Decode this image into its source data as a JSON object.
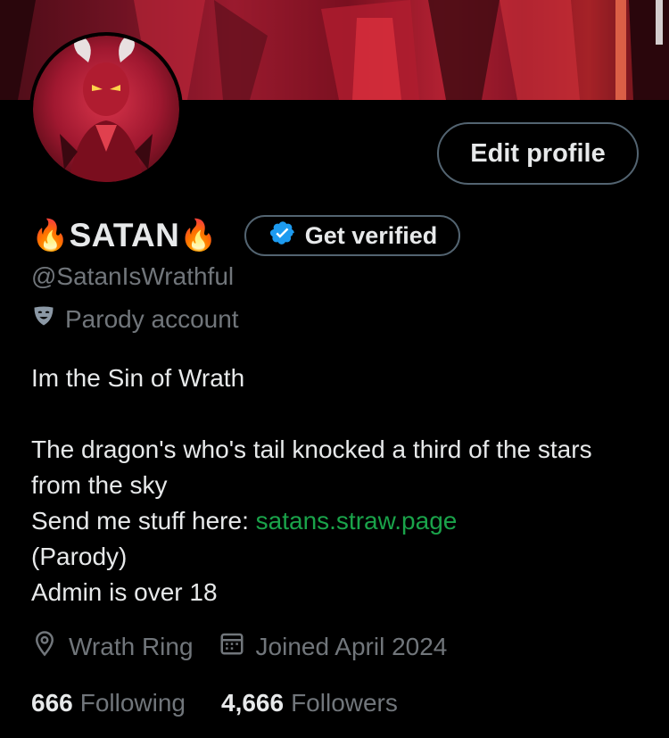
{
  "profile": {
    "display_name": "SATAN",
    "name_emoji_left": "🔥",
    "name_emoji_right": "🔥",
    "handle": "@SatanIsWrathful",
    "parody_label": "Parody account",
    "edit_profile_label": "Edit profile",
    "get_verified_label": "Get verified"
  },
  "bio": {
    "line1": "Im the Sin of Wrath",
    "line2": "The dragon's who's tail knocked a third of the stars from the sky",
    "line3_prefix": "Send me stuff here: ",
    "line3_link": "satans.straw.page",
    "line4": "(Parody)",
    "line5": "Admin is over 18"
  },
  "meta": {
    "location": "Wrath Ring",
    "joined": "Joined April 2024"
  },
  "stats": {
    "following_count": "666",
    "following_label": "Following",
    "followers_count": "4,666",
    "followers_label": "Followers"
  },
  "icons": {
    "verified": "verified-badge-icon",
    "parody": "theater-mask-icon",
    "location": "location-pin-icon",
    "calendar": "calendar-icon"
  },
  "colors": {
    "background": "#000000",
    "text_primary": "#e7e9ea",
    "text_secondary": "#71767b",
    "border": "#536471",
    "link": "#1aa34a",
    "verified_blue": "#1d9bf0"
  }
}
